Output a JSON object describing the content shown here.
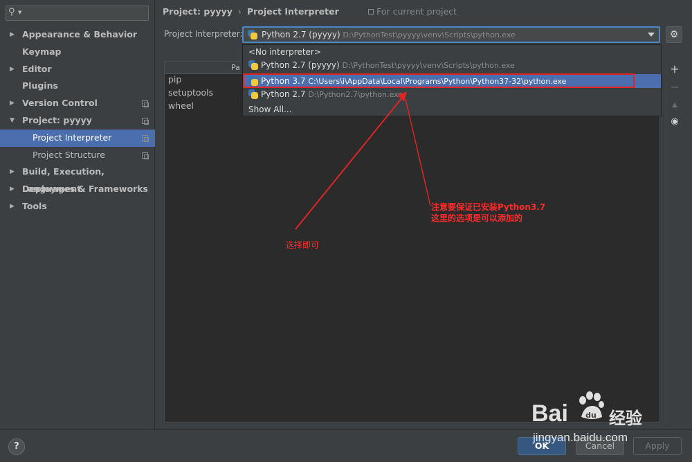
{
  "sidebar": {
    "items": [
      {
        "label": "Appearance & Behavior",
        "arrow": "▶"
      },
      {
        "label": "Keymap",
        "arrow": ""
      },
      {
        "label": "Editor",
        "arrow": "▶"
      },
      {
        "label": "Plugins",
        "arrow": ""
      },
      {
        "label": "Version Control",
        "arrow": "▶"
      },
      {
        "label": "Project: pyyyy",
        "arrow": "▼"
      },
      {
        "label": "Project Interpreter",
        "arrow": ""
      },
      {
        "label": "Project Structure",
        "arrow": ""
      },
      {
        "label": "Build, Execution, Deployment",
        "arrow": "▶"
      },
      {
        "label": "Languages & Frameworks",
        "arrow": "▶"
      },
      {
        "label": "Tools",
        "arrow": "▶"
      }
    ]
  },
  "breadcrumb": {
    "project": "Project: pyyyy",
    "separator": "›",
    "page": "Project Interpreter",
    "scope": "For current project"
  },
  "interpreter": {
    "label": "Project Interpreter:",
    "selected_name": "Python 2.7 (pyyyy)",
    "selected_path": "D:\\PythonTest\\pyyyy\\venv\\Scripts\\python.exe"
  },
  "dropdown": {
    "options": [
      {
        "name": "<No interpreter>",
        "path": ""
      },
      {
        "name": "Python 2.7 (pyyyy)",
        "path": "D:\\PythonTest\\pyyyy\\venv\\Scripts\\python.exe"
      },
      {
        "name": "Python 3.7",
        "path": "C:\\Users\\i\\AppData\\Local\\Programs\\Python\\Python37-32\\python.exe"
      },
      {
        "name": "Python 2.7",
        "path": "D:\\Python2.7\\python.exe"
      },
      {
        "name": "Show All...",
        "path": ""
      }
    ]
  },
  "packages": {
    "header": "Pa",
    "rows": [
      "pip",
      "setuptools",
      "wheel"
    ]
  },
  "toolbar": {
    "add": "+",
    "remove": "−",
    "upgrade": "▲",
    "show": "👁"
  },
  "annotations": {
    "note_line1": "注意要保证已安装Python3.7",
    "note_line2": "这里的选项是可以添加的",
    "select_hint": "选择即可"
  },
  "buttons": {
    "help": "?",
    "ok": "OK",
    "cancel": "Cancel",
    "apply": "Apply"
  },
  "watermark": {
    "logo": "Bai",
    "logo2": "du",
    "brand": "经验",
    "url": "jingyan.baidu.com"
  },
  "colors": {
    "accent": "#4b6eaf",
    "annotation": "#ff2a2a",
    "focus": "#4a88c7"
  }
}
